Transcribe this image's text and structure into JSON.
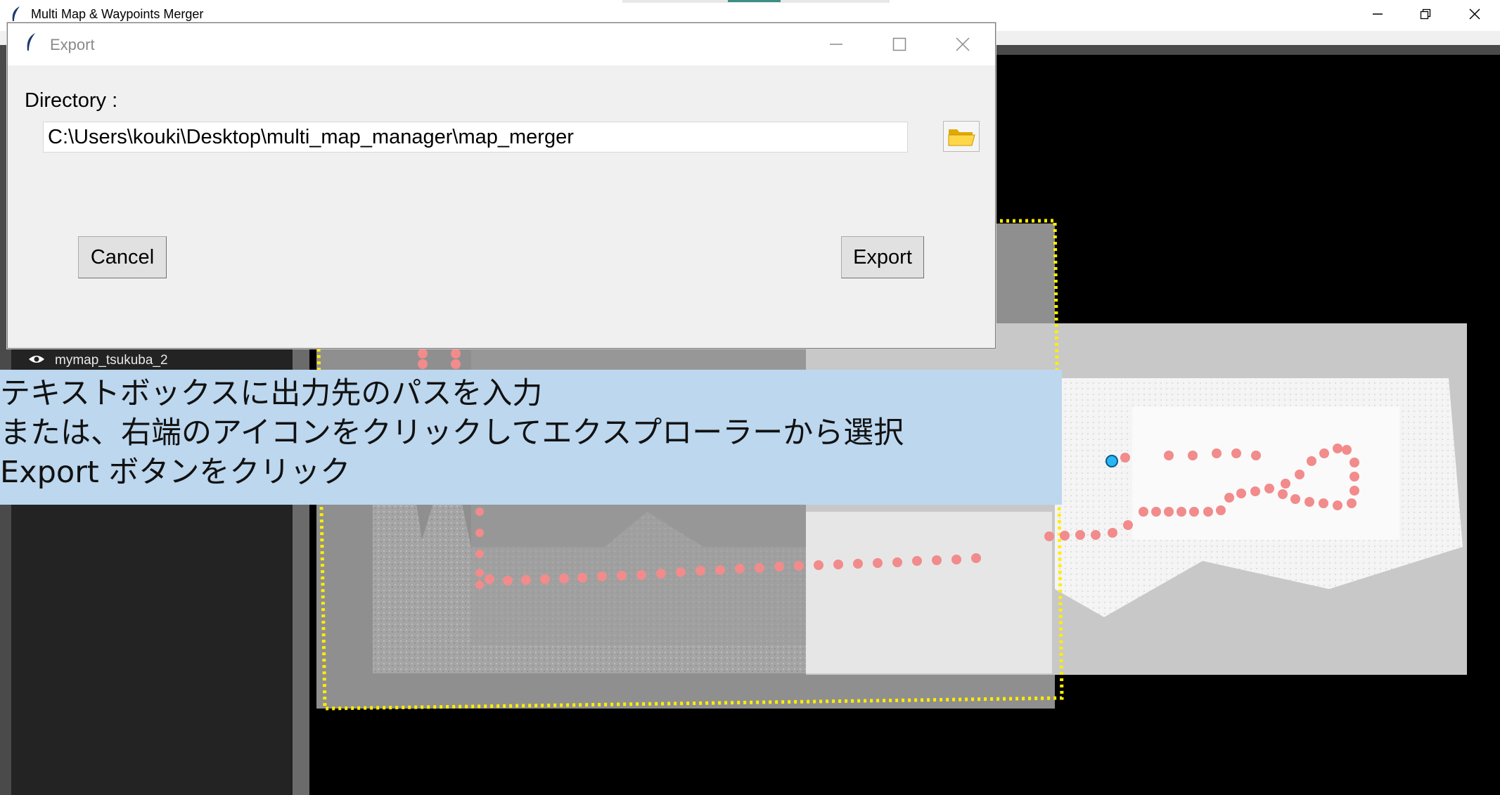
{
  "app": {
    "title": "Multi Map & Waypoints Merger"
  },
  "sidebar": {
    "layers": [
      {
        "label": "mymap_tsukuba_2",
        "icon": "eye-icon"
      }
    ]
  },
  "dialog": {
    "title": "Export",
    "directory_label": "Directory :",
    "directory_value": "C:\\Users\\kouki\\Desktop\\multi_map_manager\\map_merger",
    "cancel_label": "Cancel",
    "export_label": "Export"
  },
  "annotation": {
    "line1": "テキストボックスに出力先のパスを入力",
    "line2": "または、右端のアイコンをクリックしてエクスプローラーから選択",
    "line3": "Export ボタンをクリック"
  },
  "colors": {
    "waypoint": "#f28b8b",
    "selection_outline": "#ffee00",
    "start_marker": "#29b6f6",
    "annotation_bg": "#bcd7ee"
  }
}
